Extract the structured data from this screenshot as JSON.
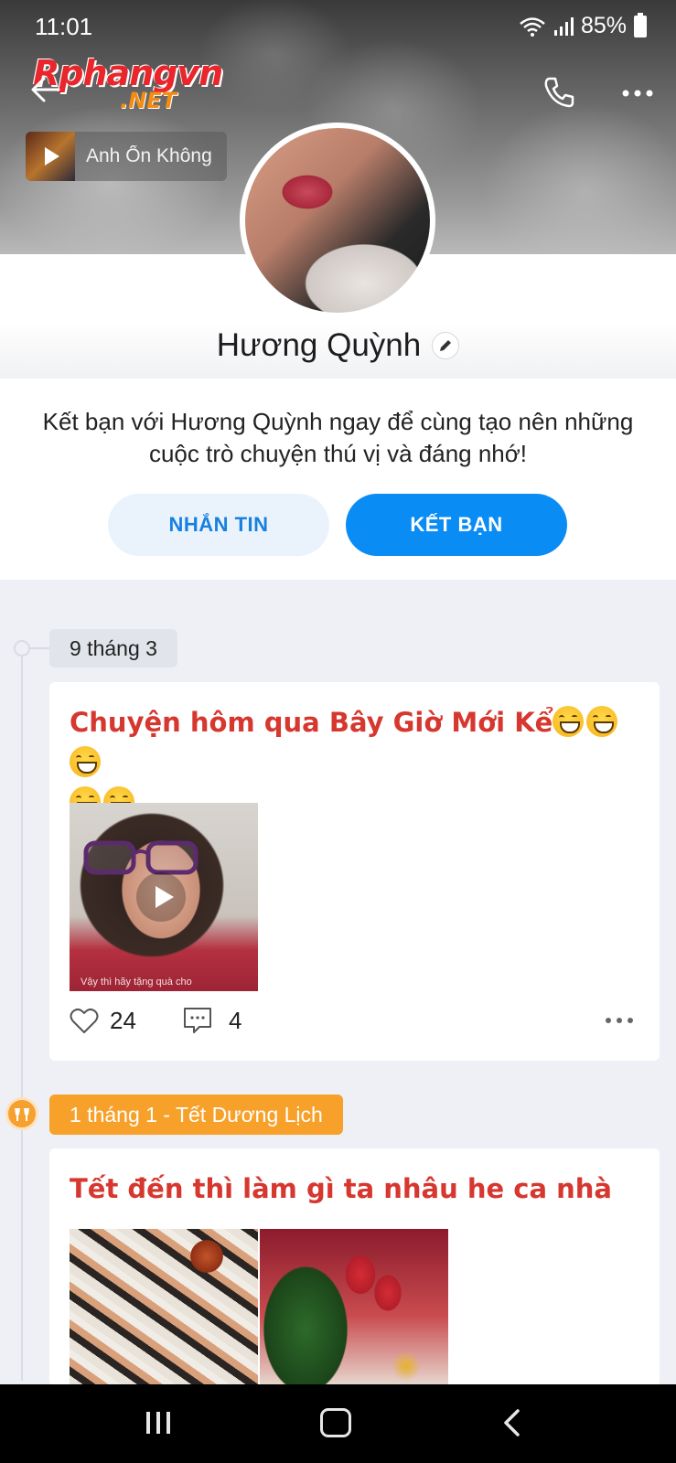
{
  "status_bar": {
    "time": "11:01",
    "battery": "85%"
  },
  "watermark": {
    "main": "Rphangvn",
    "sub": ".NET"
  },
  "music": {
    "title": "Anh Ổn Không"
  },
  "profile": {
    "name": "Hương Quỳnh"
  },
  "intro": {
    "text": "Kết bạn với Hương Quỳnh ngay để cùng tạo nên những cuộc trò chuyện thú vị và đáng nhớ!",
    "message_button": "NHẮN TIN",
    "add_friend_button": "KẾT BẠN"
  },
  "timeline": [
    {
      "date": "9 tháng 3",
      "title": "Chuyện hôm qua Bây Giờ Mới Kể",
      "emoji": "grinning-face",
      "emoji_count": 5,
      "video_caption": "Vậy thì hãy tặng quà cho",
      "likes": "24",
      "comments": "4"
    },
    {
      "date": "1 tháng 1 - Tết Dương Lịch",
      "title": "Tết đến thì làm gì ta nhâu he ca  nhà"
    }
  ],
  "colors": {
    "accent": "#0a8cf5",
    "post_title": "#d6372f",
    "festive": "#f7a12a"
  }
}
